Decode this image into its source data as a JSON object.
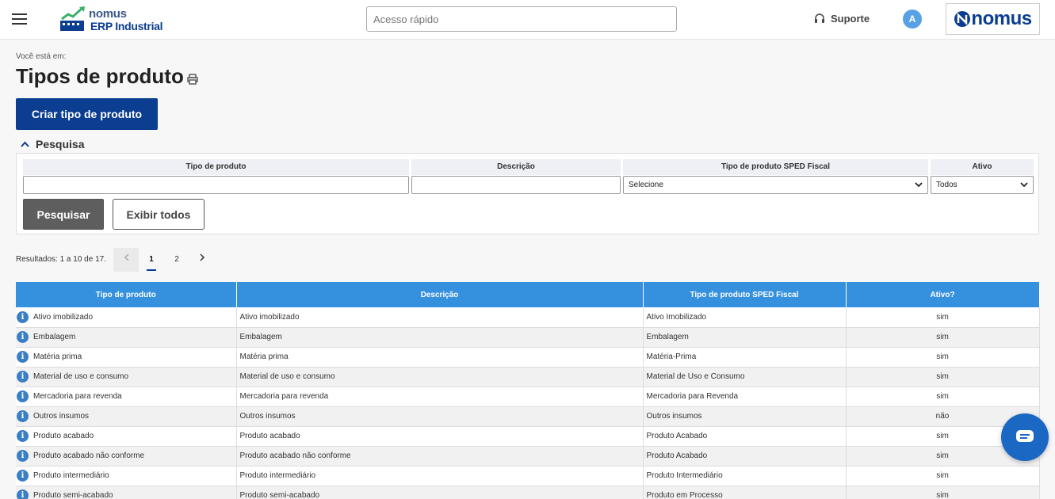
{
  "header": {
    "logo_line1": "nomus",
    "logo_line2": "ERP Industrial",
    "quick_access_placeholder": "Acesso rápido",
    "support_label": "Suporte",
    "avatar_initial": "A",
    "brand": "nomus"
  },
  "breadcrumb": "Você está em:",
  "title": "Tipos de produto",
  "create_button": "Criar tipo de produto",
  "search": {
    "toggle_label": "Pesquisa",
    "labels": {
      "tipo": "Tipo de produto",
      "descricao": "Descrição",
      "sped": "Tipo de produto SPED Fiscal",
      "ativo": "Ativo"
    },
    "values": {
      "tipo": "",
      "descricao": "",
      "sped": "Selecione",
      "ativo": "Todos"
    },
    "search_button": "Pesquisar",
    "show_all_button": "Exibir todos"
  },
  "results_text": "Resultados: 1 a 10 de 17.",
  "pagination": {
    "pages": [
      "1",
      "2"
    ],
    "current": "1"
  },
  "table": {
    "headers": [
      "Tipo de produto",
      "Descrição",
      "Tipo de produto SPED Fiscal",
      "Ativo?"
    ],
    "rows": [
      [
        "Ativo imobilizado",
        "Ativo imobilizado",
        "Ativo Imobilizado",
        "sim"
      ],
      [
        "Embalagem",
        "Embalagem",
        "Embalagem",
        "sim"
      ],
      [
        "Matéria prima",
        "Matéria prima",
        "Matéria-Prima",
        "sim"
      ],
      [
        "Material de uso e consumo",
        "Material de uso e consumo",
        "Material de Uso e Consumo",
        "sim"
      ],
      [
        "Mercadoria para revenda",
        "Mercadoria para revenda",
        "Mercadoria para Revenda",
        "sim"
      ],
      [
        "Outros insumos",
        "Outros insumos",
        "Outros insumos",
        "não"
      ],
      [
        "Produto acabado",
        "Produto acabado",
        "Produto Acabado",
        "sim"
      ],
      [
        "Produto acabado não conforme",
        "Produto acabado não conforme",
        "Produto Acabado",
        "sim"
      ],
      [
        "Produto intermediário",
        "Produto intermediário",
        "Produto Intermediário",
        "sim"
      ],
      [
        "Produto semi-acabado",
        "Produto semi-acabado",
        "Produto em Processo",
        "sim"
      ]
    ]
  },
  "colors": {
    "primary": "#0b3d91",
    "table_header": "#3590de",
    "info_icon": "#3a7fc4",
    "chat": "#1a68c4"
  }
}
